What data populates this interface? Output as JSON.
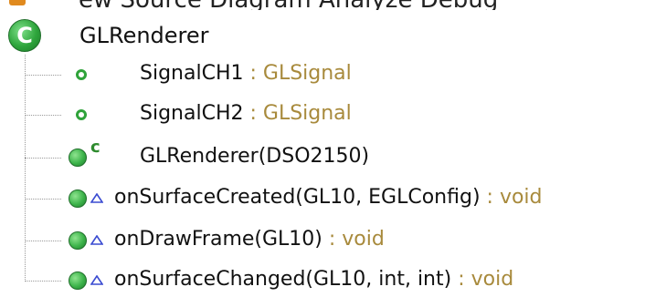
{
  "top_clip": {
    "text": "ew Source Diagram Analyze Debug"
  },
  "class_node": {
    "name": "GLRenderer",
    "icon_letter": "C"
  },
  "members": [
    {
      "kind": "field",
      "name": "SignalCH1",
      "separator": " : ",
      "type": "GLSignal"
    },
    {
      "kind": "field",
      "name": "SignalCH2",
      "separator": " : ",
      "type": "GLSignal"
    },
    {
      "kind": "constructor",
      "name": "GLRenderer(DSO2150)",
      "ctor_mark": "c",
      "separator": "",
      "type": ""
    },
    {
      "kind": "method",
      "name": "onSurfaceCreated(GL10, EGLConfig)",
      "separator": " : ",
      "type": "void"
    },
    {
      "kind": "method",
      "name": "onDrawFrame(GL10)",
      "separator": " : ",
      "type": "void"
    },
    {
      "kind": "method",
      "name": "onSurfaceChanged(GL10, int, int)",
      "separator": " : ",
      "type": "void"
    }
  ],
  "colors": {
    "icon_green": "#2fa33a",
    "type_text": "#a88a3c",
    "tree_line": "#9a9a9a",
    "visibility_mark": "#3a4bd1"
  }
}
